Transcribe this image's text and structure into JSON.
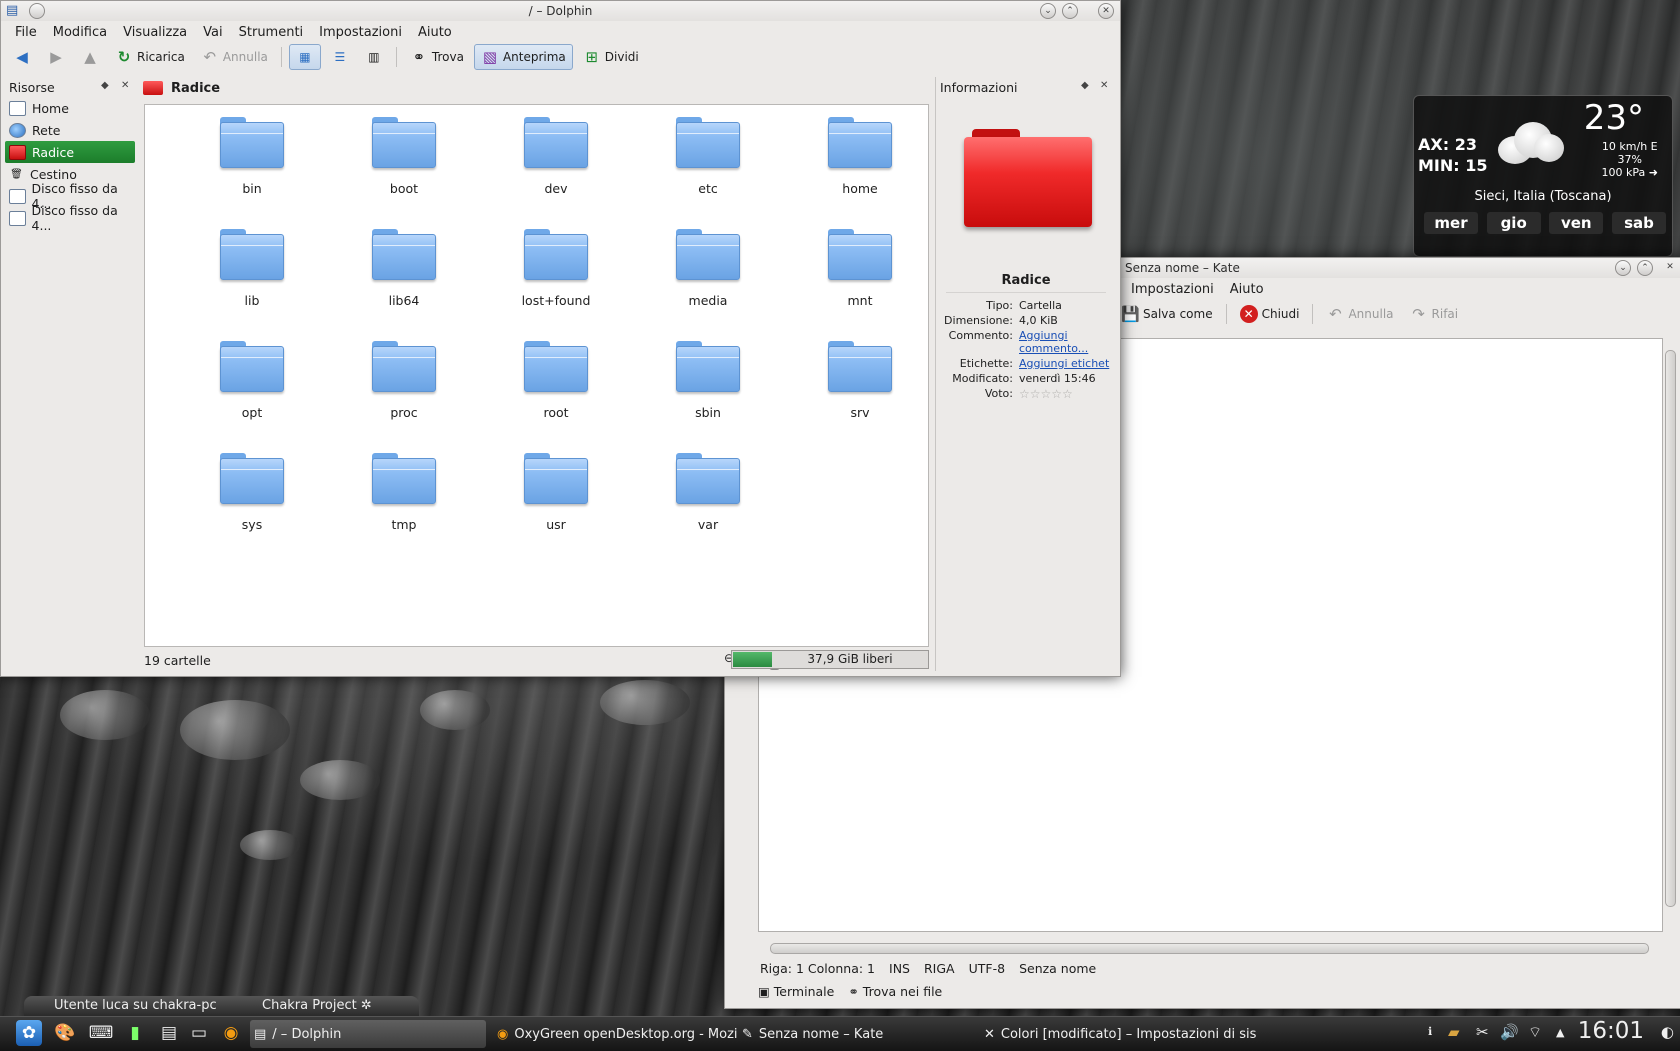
{
  "dolphin": {
    "title": "/ – Dolphin",
    "menu": [
      "File",
      "Modifica",
      "Visualizza",
      "Vai",
      "Strumenti",
      "Impostazioni",
      "Aiuto"
    ],
    "toolbar": {
      "reload": "Ricarica",
      "undo": "Annulla",
      "find": "Trova",
      "preview": "Anteprima",
      "split": "Dividi"
    },
    "places": {
      "title": "Risorse",
      "items": [
        {
          "label": "Home",
          "icon": "home-icon"
        },
        {
          "label": "Rete",
          "icon": "network-icon"
        },
        {
          "label": "Radice",
          "icon": "root-folder-icon",
          "selected": true
        },
        {
          "label": "Cestino",
          "icon": "trash-icon"
        },
        {
          "label": "Disco fisso da 4...",
          "icon": "harddisk-icon"
        },
        {
          "label": "Disco fisso da 4...",
          "icon": "harddisk-icon"
        }
      ]
    },
    "location": "Radice",
    "folders": [
      "bin",
      "boot",
      "dev",
      "etc",
      "home",
      "lib",
      "lib64",
      "lost+found",
      "media",
      "mnt",
      "opt",
      "proc",
      "root",
      "sbin",
      "srv",
      "sys",
      "tmp",
      "usr",
      "var"
    ],
    "status": {
      "count": "19 cartelle",
      "free": "37,9 GiB liberi",
      "used_fraction": 0.2
    },
    "info": {
      "title": "Informazioni",
      "name": "Radice",
      "rows": [
        {
          "k": "Tipo:",
          "v": "Cartella"
        },
        {
          "k": "Dimensione:",
          "v": "4,0 KiB"
        },
        {
          "k": "Commento:",
          "v": "Aggiungi commento...",
          "link": true
        },
        {
          "k": "Etichette:",
          "v": "Aggiungi etichet",
          "link": true
        },
        {
          "k": "Modificato:",
          "v": "venerdì 15:46"
        },
        {
          "k": "Voto:",
          "v": "☆☆☆☆☆",
          "stars": true
        }
      ]
    }
  },
  "weather": {
    "temp": "23°",
    "max": "AX: 23",
    "min": "MIN: 15",
    "wind": "10 km/h E",
    "humidity": "37%",
    "pressure": "100 kPa ➜",
    "location": "Sieci, Italia (Toscana)",
    "days": [
      "mer",
      "gio",
      "ven",
      "sab"
    ]
  },
  "kate": {
    "title": "Senza nome – Kate",
    "menu": [
      "Impostazioni",
      "Aiuto"
    ],
    "toolbar": {
      "save_as": "Salva come",
      "close": "Chiudi",
      "undo": "Annulla",
      "redo": "Rifai"
    },
    "status": [
      "Riga: 1 Colonna: 1",
      "INS",
      "RIGA",
      "UTF-8",
      "Senza nome"
    ],
    "bottom": {
      "terminal": "Terminale",
      "find_in_files": "Trova nei file"
    }
  },
  "panel_strip": {
    "left": "Utente luca su chakra-pc",
    "right": "Chakra Project ✲"
  },
  "taskbar": {
    "tasks": [
      {
        "label": "/ – Dolphin",
        "icon": "dolphin-icon",
        "active": true
      },
      {
        "label": "OxyGreen openDesktop.org - Mozilla",
        "icon": "firefox-icon"
      },
      {
        "label": "Senza nome – Kate",
        "icon": "kate-icon"
      },
      {
        "label": "Colori [modificato] – Impostazioni di siste",
        "icon": "settings-icon"
      }
    ],
    "clock": "16:01"
  }
}
